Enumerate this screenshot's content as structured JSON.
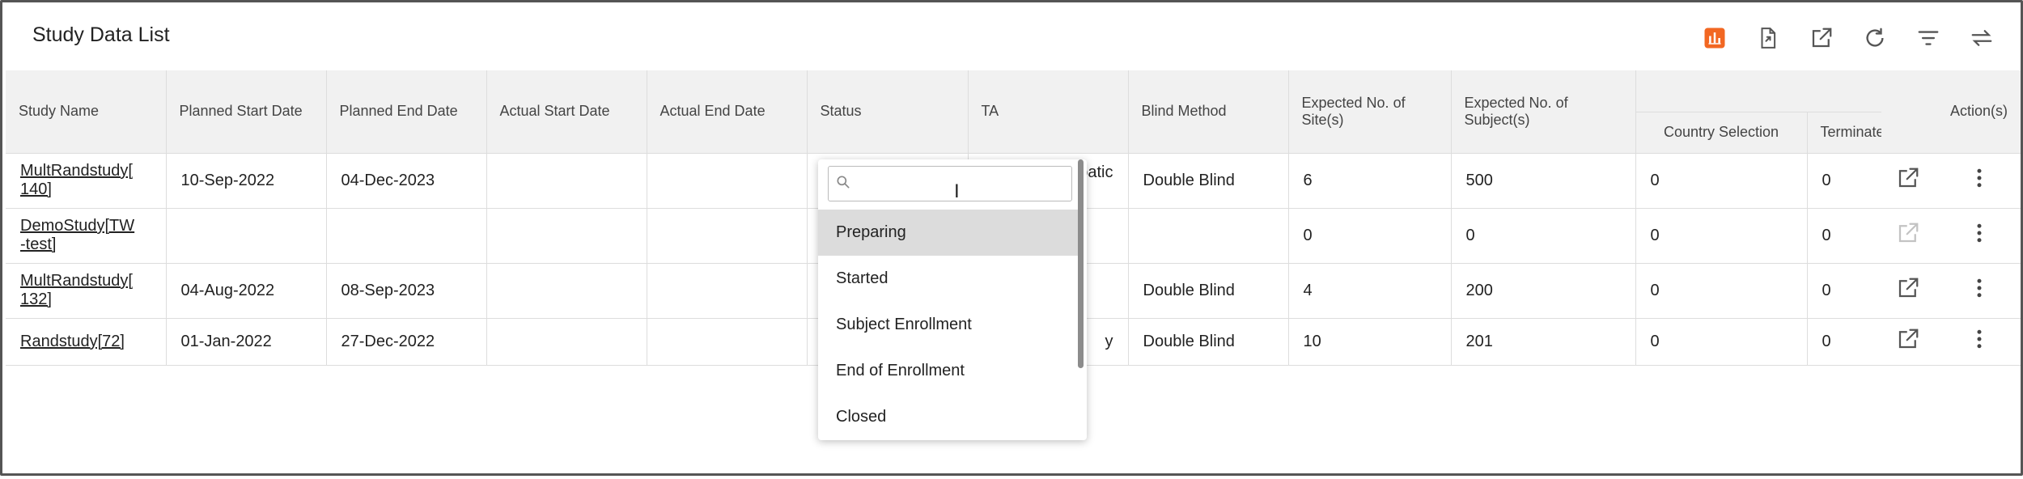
{
  "page": {
    "title": "Study Data List"
  },
  "toolbar": {
    "buttons": [
      {
        "name": "chart-icon",
        "accent": "#f26722"
      },
      {
        "name": "export-file-icon"
      },
      {
        "name": "open-new-icon"
      },
      {
        "name": "refresh-icon"
      },
      {
        "name": "filter-icon"
      },
      {
        "name": "swap-icon"
      }
    ]
  },
  "table": {
    "headers": {
      "study_name": "Study Name",
      "planned_start": "Planned Start Date",
      "planned_end": "Planned End Date",
      "actual_start": "Actual Start Date",
      "actual_end": "Actual End Date",
      "status": "Status",
      "ta": "TA",
      "blind_method": "Blind Method",
      "exp_sites": "Expected No. of Site(s)",
      "exp_subjects": "Expected No. of Subject(s)",
      "country_selection": "Country Selection",
      "terminate": "Terminate",
      "actions": "Action(s)"
    },
    "rows": [
      {
        "study_name": "MultRandstudy[ 140]",
        "planned_start": "10-Sep-2022",
        "planned_end": "04-Dec-2023",
        "actual_start": "",
        "actual_end": "",
        "ta_partial": "oatic",
        "blind_method": "Double Blind",
        "exp_sites": "6",
        "exp_subjects": "500",
        "country_selection": "0",
        "terminate": "0"
      },
      {
        "study_name": "DemoStudy[TW -test]",
        "planned_start": "",
        "planned_end": "",
        "actual_start": "",
        "actual_end": "",
        "ta_partial": "",
        "blind_method": "",
        "exp_sites": "0",
        "exp_subjects": "0",
        "country_selection": "0",
        "terminate": "0"
      },
      {
        "study_name": "MultRandstudy[ 132]",
        "planned_start": "04-Aug-2022",
        "planned_end": "08-Sep-2023",
        "actual_start": "",
        "actual_end": "",
        "ta_partial": "",
        "blind_method": "Double Blind",
        "exp_sites": "4",
        "exp_subjects": "200",
        "country_selection": "0",
        "terminate": "0"
      },
      {
        "study_name": "Randstudy[72]",
        "planned_start": "01-Jan-2022",
        "planned_end": "27-Dec-2022",
        "actual_start": "",
        "actual_end": "",
        "ta_partial": "y",
        "blind_method": "Double Blind",
        "exp_sites": "10",
        "exp_subjects": "201",
        "country_selection": "0",
        "terminate": "0"
      }
    ]
  },
  "status_dropdown": {
    "search_value": "",
    "options": [
      "Preparing",
      "Started",
      "Subject Enrollment",
      "End of Enrollment",
      "Closed"
    ],
    "highlighted": "Preparing"
  }
}
